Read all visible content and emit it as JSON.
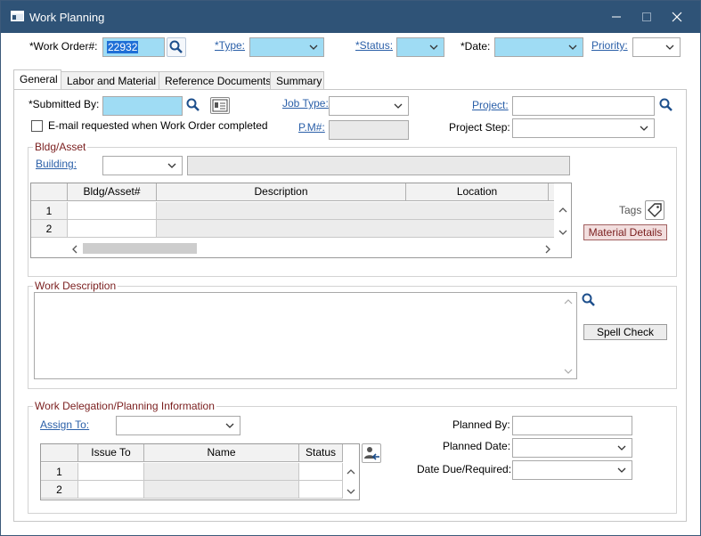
{
  "window": {
    "title": "Work Planning"
  },
  "header": {
    "work_order_label": "*Work Order#:",
    "work_order_value": "22932",
    "type_label": "*Type:",
    "status_label": "*Status:",
    "date_label": "*Date:",
    "priority_label": "Priority:"
  },
  "tabs": [
    {
      "label": "General"
    },
    {
      "label": "Labor and Material"
    },
    {
      "label": "Reference Documents"
    },
    {
      "label": "Summary"
    }
  ],
  "general": {
    "submitted_by_label": "*Submitted By:",
    "email_label": "E-mail requested when Work Order completed",
    "job_type_label": "Job Type:",
    "pm_label": "P.M#:",
    "project_label": "Project:",
    "project_step_label": "Project Step:"
  },
  "bldg": {
    "group_title": "Bldg/Asset",
    "building_label": "Building:",
    "columns": [
      "Bldg/Asset#",
      "Description",
      "Location"
    ],
    "rows": [
      "1",
      "2"
    ],
    "tags_label": "Tags",
    "material_details_label": "Material  Details"
  },
  "work_description": {
    "group_title": "Work Description",
    "spell_check_label": "Spell Check"
  },
  "delegation": {
    "group_title": "Work Delegation/Planning Information",
    "assign_to_label": "Assign To:",
    "columns": [
      "Issue To",
      "Name",
      "Status"
    ],
    "rows": [
      "1",
      "2"
    ],
    "planned_by_label": "Planned By:",
    "planned_date_label": "Planned Date:",
    "date_due_label": "Date Due/Required:"
  },
  "colors": {
    "titlebar": "#2f5377",
    "required_field": "#9fdcf4",
    "group_title": "#7a1e1e",
    "link": "#2a5fa8"
  }
}
